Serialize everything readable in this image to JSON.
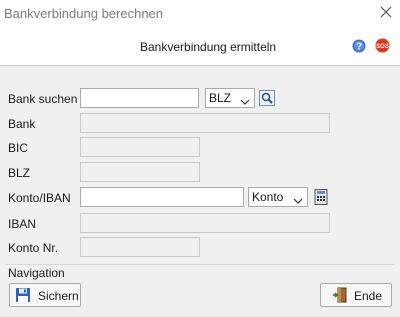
{
  "window": {
    "title": "Bankverbindung berechnen"
  },
  "header": {
    "title": "Bankverbindung ermitteln"
  },
  "form": {
    "bank_suchen": {
      "label": "Bank suchen",
      "value": "",
      "mode": "BLZ"
    },
    "bank": {
      "label": "Bank",
      "value": ""
    },
    "bic": {
      "label": "BIC",
      "value": ""
    },
    "blz": {
      "label": "BLZ",
      "value": ""
    },
    "konto_iban": {
      "label": "Konto/IBAN",
      "value": "",
      "mode": "Konto"
    },
    "iban": {
      "label": "IBAN",
      "value": ""
    },
    "konto_nr": {
      "label": "Konto Nr.",
      "value": ""
    }
  },
  "navigation": {
    "label": "Navigation",
    "save_label": "Sichern",
    "end_label": "Ende"
  },
  "icons": {
    "close": "close-icon",
    "help": "help-icon",
    "sos": "sos-icon",
    "search": "search-icon",
    "calculator": "calculator-icon",
    "save": "save-icon",
    "exit": "exit-door-icon"
  },
  "colors": {
    "help_blue": "#3a6fd0",
    "sos_red": "#e2341d"
  }
}
